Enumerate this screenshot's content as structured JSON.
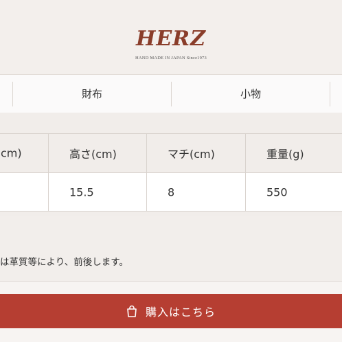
{
  "header": {
    "logo_text": "HERZ",
    "tagline": "HAND MADE IN JAPAN Since1973"
  },
  "nav": {
    "tabs": [
      {
        "label": "財布"
      },
      {
        "label": "小物"
      }
    ]
  },
  "spec_table": {
    "headers": [
      "cm)",
      "高さ(cm)",
      "マチ(cm)",
      "重量(g)"
    ],
    "values": [
      "",
      "15.5",
      "8",
      "550"
    ]
  },
  "note": "は革質等により、前後します。",
  "buy_button": {
    "label": "購入はこちら",
    "icon": "shopping-bag-icon"
  },
  "colors": {
    "brand": "#8a3d2a",
    "button": "#b63e32"
  }
}
